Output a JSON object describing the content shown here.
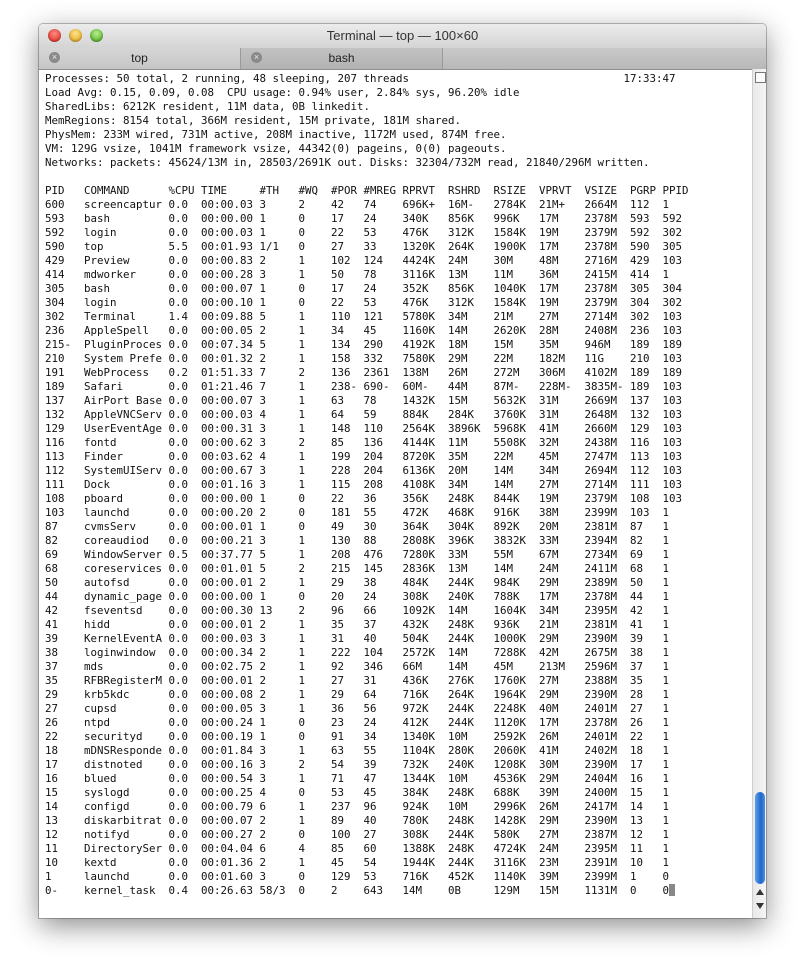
{
  "window": {
    "title": "Terminal — top — 100×60"
  },
  "tabs": [
    {
      "label": "top"
    },
    {
      "label": "bash"
    }
  ],
  "icons": {
    "close": "close-icon",
    "minimize": "minimize-icon",
    "zoom": "zoom-icon",
    "tab_close": "x-circle-icon"
  },
  "terminal": {
    "lines": [
      "Processes: 50 total, 2 running, 48 sleeping, 207 threads                                 17:33:47",
      "Load Avg: 0.15, 0.09, 0.08  CPU usage: 0.94% user, 2.84% sys, 96.20% idle",
      "SharedLibs: 6212K resident, 11M data, 0B linkedit.",
      "MemRegions: 8154 total, 366M resident, 15M private, 181M shared.",
      "PhysMem: 233M wired, 731M active, 208M inactive, 1172M used, 874M free.",
      "VM: 129G vsize, 1041M framework vsize, 44342(0) pageins, 0(0) pageouts.",
      "Networks: packets: 45624/13M in, 28503/2691K out. Disks: 32304/732M read, 21840/296M written.",
      "",
      "PID   COMMAND      %CPU TIME     #TH   #WQ  #POR #MREG RPRVT  RSHRD  RSIZE  VPRVT  VSIZE  PGRP PPID",
      "600   screencaptur 0.0  00:00.03 3     2    42   74    696K+  16M-   2784K  21M+   2664M  112  1",
      "593   bash         0.0  00:00.00 1     0    17   24    340K   856K   996K   17M    2378M  593  592",
      "592   login        0.0  00:00.03 1     0    22   53    476K   312K   1584K  19M    2379M  592  302",
      "590   top          5.5  00:01.93 1/1   0    27   33    1320K  264K   1900K  17M    2378M  590  305",
      "429   Preview      0.0  00:00.83 2     1    102  124   4424K  24M    30M    48M    2716M  429  103",
      "414   mdworker     0.0  00:00.28 3     1    50   78    3116K  13M    11M    36M    2415M  414  1",
      "305   bash         0.0  00:00.07 1     0    17   24    352K   856K   1040K  17M    2378M  305  304",
      "304   login        0.0  00:00.10 1     0    22   53    476K   312K   1584K  19M    2379M  304  302",
      "302   Terminal     1.4  00:09.88 5     1    110  121   5780K  34M    21M    27M    2714M  302  103",
      "236   AppleSpell   0.0  00:00.05 2     1    34   45    1160K  14M    2620K  28M    2408M  236  103",
      "215-  PluginProces 0.0  00:07.34 5     1    134  290   4192K  18M    15M    35M    946M   189  189",
      "210   System Prefe 0.0  00:01.32 2     1    158  332   7580K  29M    22M    182M   11G    210  103",
      "191   WebProcess   0.2  01:51.33 7     2    136  2361  138M   26M    272M   306M   4102M  189  189",
      "189   Safari       0.0  01:21.46 7     1    238- 690-  60M-   44M    87M-   228M-  3835M- 189  103",
      "137   AirPort Base 0.0  00:00.07 3     1    63   78    1432K  15M    5632K  31M    2669M  137  103",
      "132   AppleVNCServ 0.0  00:00.03 4     1    64   59    884K   284K   3760K  31M    2648M  132  103",
      "129   UserEventAge 0.0  00:00.31 3     1    148  110   2564K  3896K  5968K  41M    2660M  129  103",
      "116   fontd        0.0  00:00.62 3     2    85   136   4144K  11M    5508K  32M    2438M  116  103",
      "113   Finder       0.0  00:03.62 4     1    199  204   8720K  35M    22M    45M    2747M  113  103",
      "112   SystemUIServ 0.0  00:00.67 3     1    228  204   6136K  20M    14M    34M    2694M  112  103",
      "111   Dock         0.0  00:01.16 3     1    115  208   4108K  34M    14M    27M    2714M  111  103",
      "108   pboard       0.0  00:00.00 1     0    22   36    356K   248K   844K   19M    2379M  108  103",
      "103   launchd      0.0  00:00.20 2     0    181  55    472K   468K   916K   38M    2399M  103  1",
      "87    cvmsServ     0.0  00:00.01 1     0    49   30    364K   304K   892K   20M    2381M  87   1",
      "82    coreaudiod   0.0  00:00.21 3     1    130  88    2808K  396K   3832K  33M    2394M  82   1",
      "69    WindowServer 0.5  00:37.77 5     1    208  476   7280K  33M    55M    67M    2734M  69   1",
      "68    coreservices 0.0  00:01.01 5     2    215  145   2836K  13M    14M    24M    2411M  68   1",
      "50    autofsd      0.0  00:00.01 2     1    29   38    484K   244K   984K   29M    2389M  50   1",
      "44    dynamic_page 0.0  00:00.00 1     0    20   24    308K   240K   788K   17M    2378M  44   1",
      "42    fseventsd    0.0  00:00.30 13    2    96   66    1092K  14M    1604K  34M    2395M  42   1",
      "41    hidd         0.0  00:00.01 2     1    35   37    432K   248K   936K   21M    2381M  41   1",
      "39    KernelEventA 0.0  00:00.03 3     1    31   40    504K   244K   1000K  29M    2390M  39   1",
      "38    loginwindow  0.0  00:00.34 2     1    222  104   2572K  14M    7288K  42M    2675M  38   1",
      "37    mds          0.0  00:02.75 2     1    92   346   66M    14M    45M    213M   2596M  37   1",
      "35    RFBRegisterM 0.0  00:00.01 2     1    27   31    436K   276K   1760K  27M    2388M  35   1",
      "29    krb5kdc      0.0  00:00.08 2     1    29   64    716K   264K   1964K  29M    2390M  28   1",
      "27    cupsd        0.0  00:00.05 3     1    36   56    972K   244K   2248K  40M    2401M  27   1",
      "26    ntpd         0.0  00:00.24 1     0    23   24    412K   244K   1120K  17M    2378M  26   1",
      "22    securityd    0.0  00:00.19 1     0    91   34    1340K  10M    2592K  26M    2401M  22   1",
      "18    mDNSResponde 0.0  00:01.84 3     1    63   55    1104K  280K   2060K  41M    2402M  18   1",
      "17    distnoted    0.0  00:00.16 3     2    54   39    732K   240K   1208K  30M    2390M  17   1",
      "16    blued        0.0  00:00.54 3     1    71   47    1344K  10M    4536K  29M    2404M  16   1",
      "15    syslogd      0.0  00:00.25 4     0    53   45    384K   248K   688K   39M    2400M  15   1",
      "14    configd      0.0  00:00.79 6     1    237  96    924K   10M    2996K  26M    2417M  14   1",
      "13    diskarbitrat 0.0  00:00.07 2     1    89   40    780K   248K   1428K  29M    2390M  13   1",
      "12    notifyd      0.0  00:00.27 2     0    100  27    308K   244K   580K   27M    2387M  12   1",
      "11    DirectorySer 0.0  00:04.04 6     4    85   60    1388K  248K   4724K  24M    2395M  11   1",
      "10    kextd        0.0  00:01.36 2     1    45   54    1944K  244K   3116K  23M    2391M  10   1",
      "1     launchd      0.0  00:01.60 3     0    129  53    716K   452K   1140K  39M    2399M  1    0",
      "0-    kernel_task  0.4  00:26.63 58/3  0    2    643   14M    0B     129M   15M    1131M  0    0"
    ]
  }
}
